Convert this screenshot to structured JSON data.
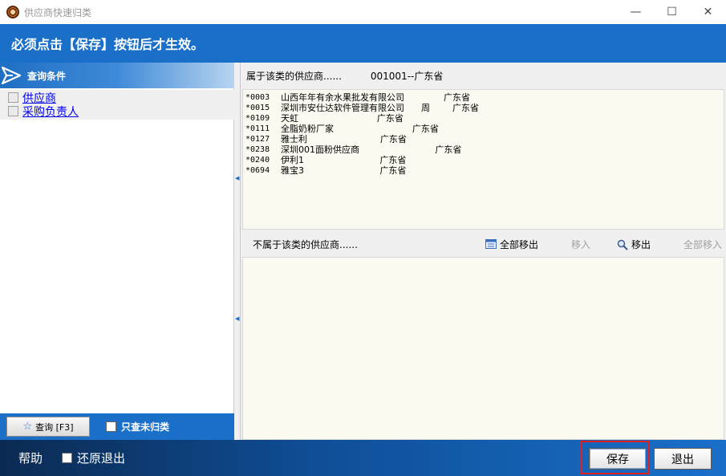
{
  "window": {
    "title": "供应商快速归类",
    "controls": {
      "minimize": "—",
      "maximize": "☐",
      "close": "✕"
    }
  },
  "banner": {
    "text": "必须点击【保存】按钮后才生效。"
  },
  "left": {
    "header": "查询条件",
    "conditions": [
      "供应商",
      "采购负责人"
    ],
    "query_button": "查询 [F3]",
    "only_unclassified": "只查未归类"
  },
  "belong": {
    "label": "属于该类的供应商......",
    "category": "001001--广东省",
    "rows": [
      {
        "code": "*0003",
        "text": "山西年年有余水果批发有限公司              广东省"
      },
      {
        "code": "*0015",
        "text": "深圳市安仕达软件管理有限公司      周        广东省"
      },
      {
        "code": "*0109",
        "text": "天虹                            广东省"
      },
      {
        "code": "*0111",
        "text": "全脂奶粉厂家                            广东省"
      },
      {
        "code": "*0127",
        "text": "雅士利                          广东省"
      },
      {
        "code": "*0238",
        "text": "深圳001面粉供应商                           广东省"
      },
      {
        "code": "*0240",
        "text": "伊利1                           广东省"
      },
      {
        "code": "*0694",
        "text": "雅宝3                           广东省"
      }
    ]
  },
  "notbelong": {
    "label": "不属于该类的供应商......",
    "toolbar": {
      "move_out_all": "全部移出",
      "move_in": "移入",
      "move_out": "移出",
      "move_in_all": "全部移入"
    }
  },
  "bottom": {
    "help": "帮助",
    "restore_exit": "还原退出",
    "save": "保存",
    "exit": "退出"
  },
  "colors": {
    "accent": "#1a6fc9",
    "highlight": "#e02020"
  }
}
